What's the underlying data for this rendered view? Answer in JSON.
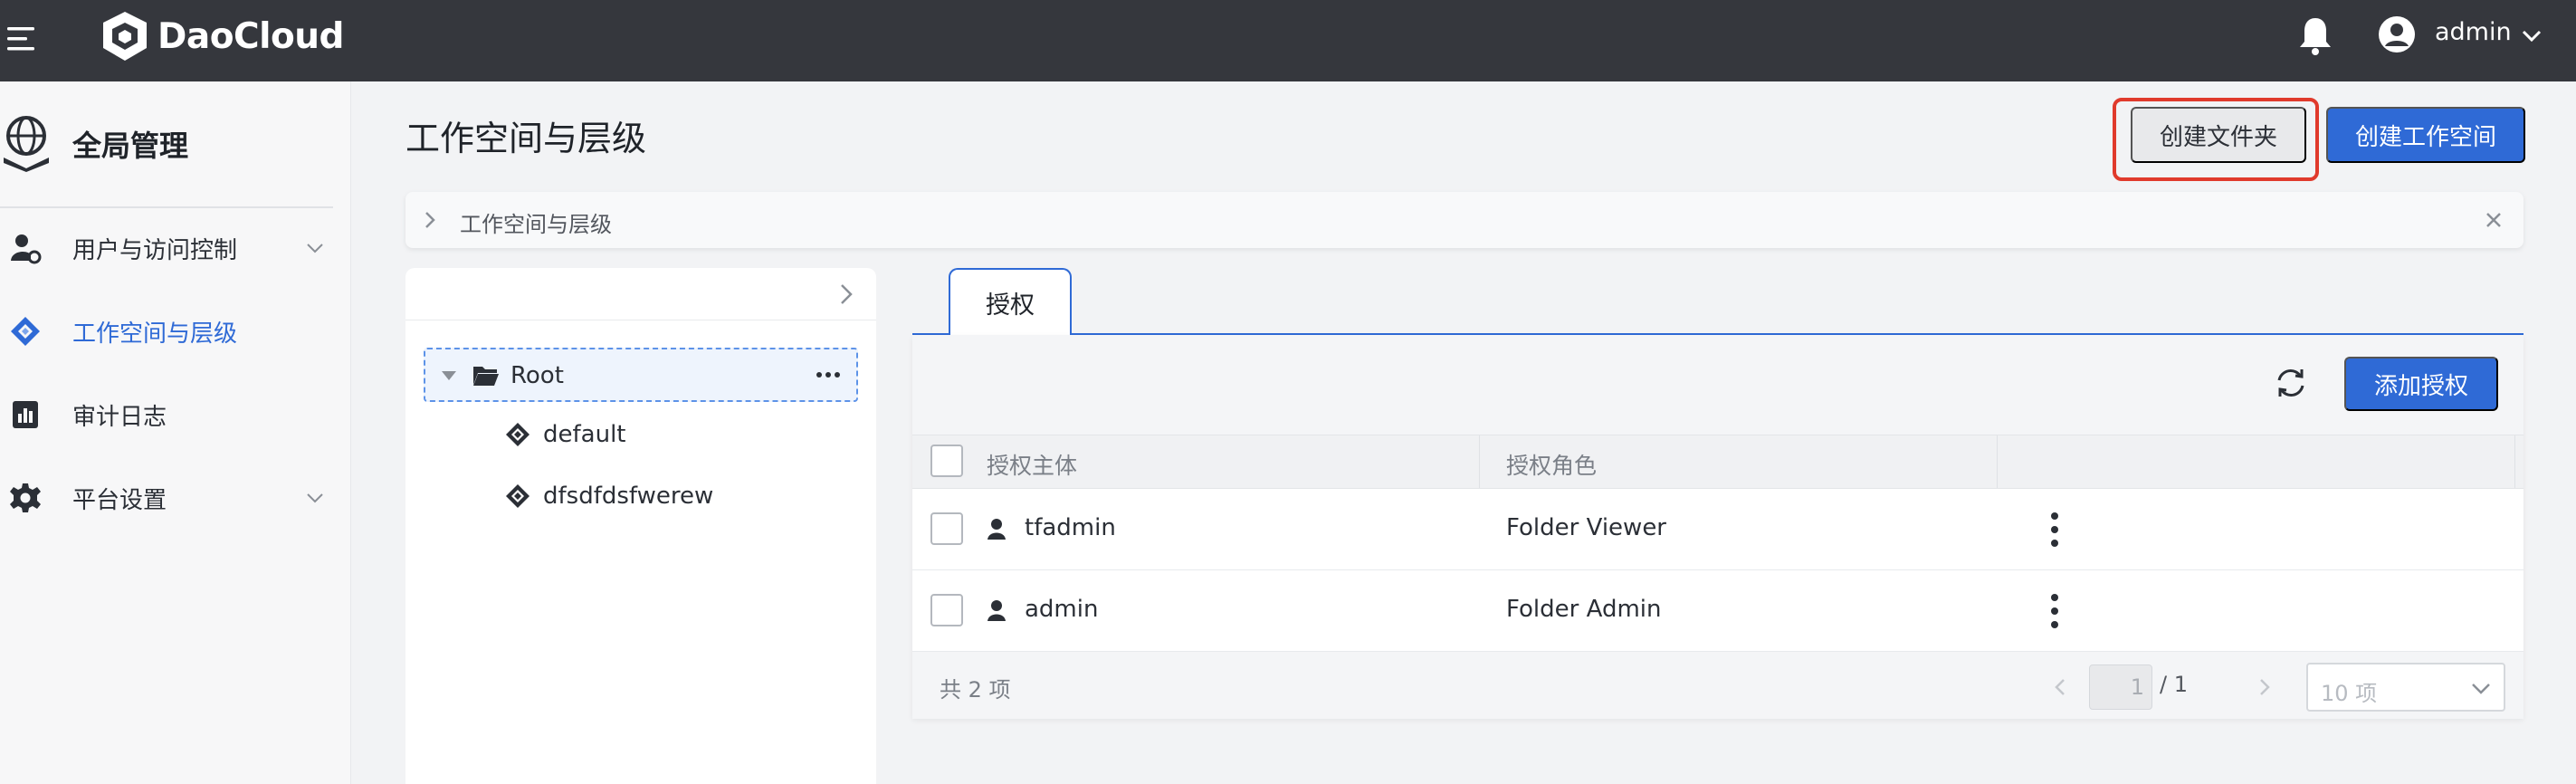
{
  "topbar": {
    "brand": "DaoCloud",
    "user_name": "admin"
  },
  "sidebar": {
    "section_title": "全局管理",
    "items": [
      {
        "label": "用户与访问控制",
        "icon": "user-settings-icon",
        "expandable": true
      },
      {
        "label": "工作空间与层级",
        "icon": "workspace-icon",
        "active": true
      },
      {
        "label": "审计日志",
        "icon": "audit-log-icon"
      },
      {
        "label": "平台设置",
        "icon": "gear-icon",
        "expandable": true
      }
    ]
  },
  "header": {
    "title": "工作空间与层级",
    "create_folder_label": "创建文件夹",
    "create_workspace_label": "创建工作空间"
  },
  "breadcrumb": {
    "text": "工作空间与层级"
  },
  "tree": {
    "root_label": "Root",
    "children": [
      {
        "label": "default"
      },
      {
        "label": "dfsdfdsfwerew"
      }
    ]
  },
  "tabs": [
    {
      "label": "授权",
      "active": true
    }
  ],
  "table": {
    "add_button_label": "添加授权",
    "columns": [
      "授权主体",
      "授权角色"
    ],
    "rows": [
      {
        "subject": "tfadmin",
        "role": "Folder Viewer"
      },
      {
        "subject": "admin",
        "role": "Folder Admin"
      }
    ]
  },
  "pagination": {
    "total_text": "共 2 项",
    "current_page": "1",
    "total_pages": "/ 1",
    "page_size": "10 项"
  },
  "colors": {
    "topbar": "#35373d",
    "primary": "#2f6ad6",
    "highlight": "#e03a2c"
  }
}
